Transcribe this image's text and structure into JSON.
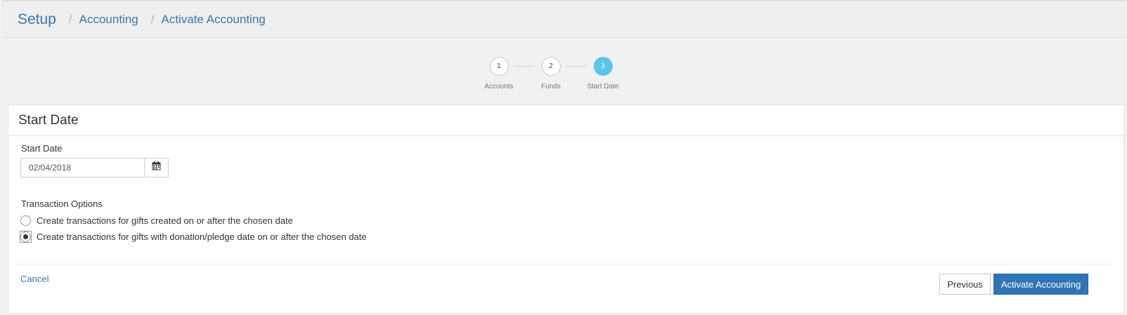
{
  "breadcrumb": {
    "root": "Setup",
    "separator": "/",
    "items": [
      "Accounting",
      "Activate Accounting"
    ]
  },
  "wizard": {
    "steps": [
      {
        "number": "1",
        "label": "Accounts"
      },
      {
        "number": "2",
        "label": "Funds"
      },
      {
        "number": "3",
        "label": "Start Date"
      }
    ],
    "active_step": 3
  },
  "card": {
    "title": "Start Date",
    "start_date": {
      "label": "Start Date",
      "value": "02/04/2018",
      "calendar_icon": "calendar-icon"
    },
    "transaction_options": {
      "label": "Transaction Options",
      "options": [
        {
          "label": "Create transactions for gifts created on or after the chosen date",
          "checked": false
        },
        {
          "label": "Create transactions for gifts with donation/pledge date on or after the chosen date",
          "checked": true
        }
      ]
    },
    "footer": {
      "cancel_label": "Cancel",
      "previous_label": "Previous",
      "activate_label": "Activate Accounting"
    }
  },
  "colors": {
    "link": "#3a76b0",
    "active_step": "#5bc4eb",
    "primary_button": "#2f74b5"
  }
}
